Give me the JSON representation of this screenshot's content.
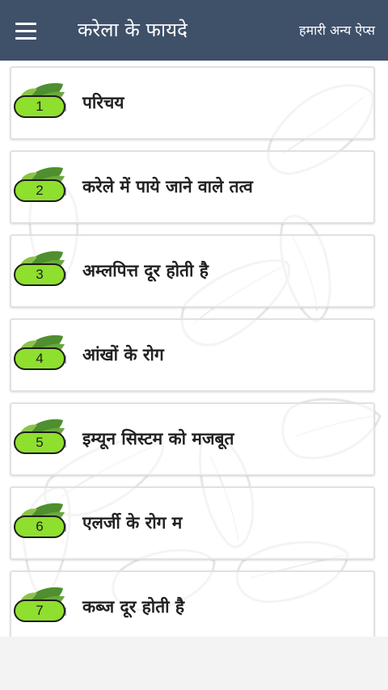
{
  "topbar": {
    "menu_icon": "hamburger-menu-icon",
    "title": "करेला के फायदे",
    "other_apps": "हमारी अन्य ऐप्स",
    "background_color": "#3f5069"
  },
  "items": [
    {
      "number": "1",
      "label": "परिचय"
    },
    {
      "number": "2",
      "label": "करेले में पाये जाने वाले तत्व"
    },
    {
      "number": "3",
      "label": "अम्लपित्त दूर होती है"
    },
    {
      "number": "4",
      "label": "आंखों के रोग"
    },
    {
      "number": "5",
      "label": "इम्यून सिस्टम को मजबूत"
    },
    {
      "number": "6",
      "label": "एलर्जी के रोग म"
    },
    {
      "number": "7",
      "label": "कब्ज दूर होती है"
    }
  ],
  "item_icon": "bitter-gourd-leaf-icon",
  "badge_color": "#8fdf2e"
}
